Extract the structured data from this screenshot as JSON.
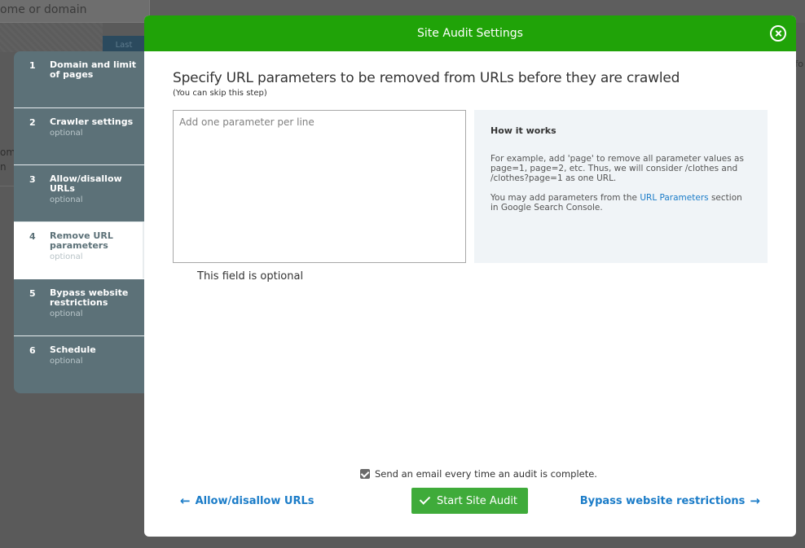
{
  "background": {
    "search_placeholder": "ome or domain",
    "button_label": "Last",
    "left_text": "om\nn",
    "right_text": "fo"
  },
  "steps": [
    {
      "num": "1",
      "title": "Domain and limit of pages",
      "subtitle": ""
    },
    {
      "num": "2",
      "title": "Crawler settings",
      "subtitle": "optional"
    },
    {
      "num": "3",
      "title": "Allow/disallow URLs",
      "subtitle": "optional"
    },
    {
      "num": "4",
      "title": "Remove URL parameters",
      "subtitle": "optional",
      "active": true
    },
    {
      "num": "5",
      "title": "Bypass website restrictions",
      "subtitle": "optional"
    },
    {
      "num": "6",
      "title": "Schedule",
      "subtitle": "optional"
    }
  ],
  "modal": {
    "title": "Site Audit Settings",
    "heading": "Specify URL parameters to be removed from URLs before they are crawled",
    "hint": "(You can skip this step)",
    "textarea_placeholder": "Add one parameter per line",
    "optional_note": "This field is optional",
    "info": {
      "title": "How it works",
      "p1": "For example, add 'page' to remove all parameter values as page=1, page=2, etc. Thus, we will consider /clothes and /clothes?page=1 as one URL.",
      "p2_before": "You may add parameters from the ",
      "p2_link": "URL Parameters",
      "p2_after": " section in Google Search Console."
    },
    "email_label": "Send an email every time an audit is complete.",
    "back_label": "Allow/disallow URLs",
    "start_label": "Start Site Audit",
    "next_label": "Bypass website restrictions",
    "back_arrow": "←",
    "next_arrow": "→"
  },
  "colors": {
    "header_green": "#20a308",
    "button_green": "#3fab3a",
    "link_blue": "#1b7cc8",
    "sidebar": "#5c7178"
  }
}
